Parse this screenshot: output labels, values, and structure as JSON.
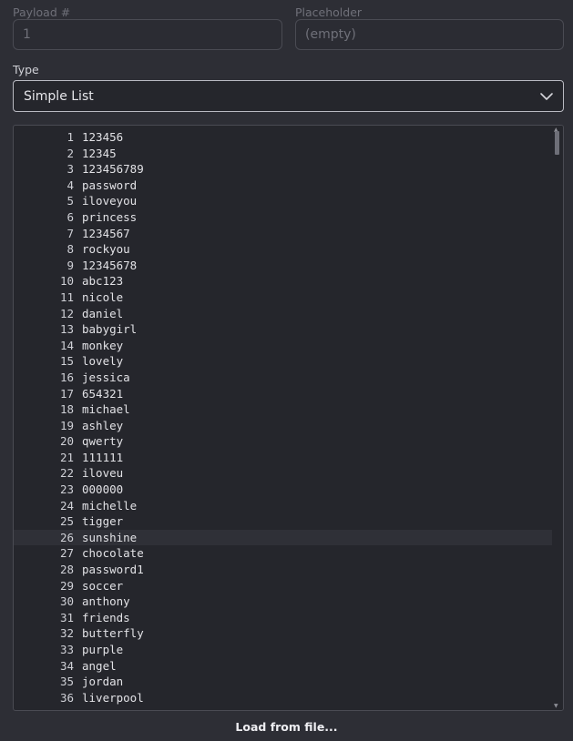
{
  "payload_number": {
    "label": "Payload #",
    "value": "1"
  },
  "placeholder": {
    "label": "Placeholder",
    "value": "(empty)"
  },
  "type": {
    "label": "Type",
    "selected": "Simple List"
  },
  "editor": {
    "current_line": 26,
    "lines": [
      {
        "n": "1",
        "text": "123456"
      },
      {
        "n": "2",
        "text": "12345"
      },
      {
        "n": "3",
        "text": "123456789"
      },
      {
        "n": "4",
        "text": "password"
      },
      {
        "n": "5",
        "text": "iloveyou"
      },
      {
        "n": "6",
        "text": "princess"
      },
      {
        "n": "7",
        "text": "1234567"
      },
      {
        "n": "8",
        "text": "rockyou"
      },
      {
        "n": "9",
        "text": "12345678"
      },
      {
        "n": "10",
        "text": "abc123"
      },
      {
        "n": "11",
        "text": "nicole"
      },
      {
        "n": "12",
        "text": "daniel"
      },
      {
        "n": "13",
        "text": "babygirl"
      },
      {
        "n": "14",
        "text": "monkey"
      },
      {
        "n": "15",
        "text": "lovely"
      },
      {
        "n": "16",
        "text": "jessica"
      },
      {
        "n": "17",
        "text": "654321"
      },
      {
        "n": "18",
        "text": "michael"
      },
      {
        "n": "19",
        "text": "ashley"
      },
      {
        "n": "20",
        "text": "qwerty"
      },
      {
        "n": "21",
        "text": "111111"
      },
      {
        "n": "22",
        "text": "iloveu"
      },
      {
        "n": "23",
        "text": "000000"
      },
      {
        "n": "24",
        "text": "michelle"
      },
      {
        "n": "25",
        "text": "tigger"
      },
      {
        "n": "26",
        "text": "sunshine"
      },
      {
        "n": "27",
        "text": "chocolate"
      },
      {
        "n": "28",
        "text": "password1"
      },
      {
        "n": "29",
        "text": "soccer"
      },
      {
        "n": "30",
        "text": "anthony"
      },
      {
        "n": "31",
        "text": "friends"
      },
      {
        "n": "32",
        "text": "butterfly"
      },
      {
        "n": "33",
        "text": "purple"
      },
      {
        "n": "34",
        "text": "angel"
      },
      {
        "n": "35",
        "text": "jordan"
      },
      {
        "n": "36",
        "text": "liverpool"
      }
    ]
  },
  "load_button": {
    "label": "Load from file..."
  },
  "icons": {
    "select_chevron": "chevron-down-icon"
  }
}
